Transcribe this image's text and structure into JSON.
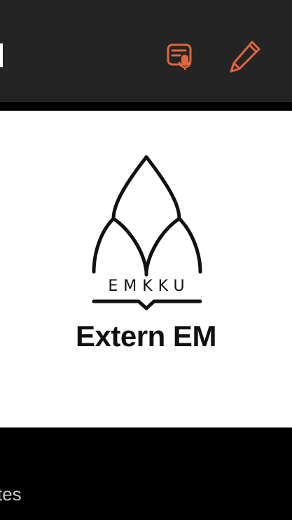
{
  "header": {
    "background": "#242424",
    "accent": "#E0663D",
    "actions": [
      {
        "icon": "transcript-mic-icon"
      },
      {
        "icon": "pencil-edit-icon"
      }
    ]
  },
  "hero": {
    "background": "#ffffff",
    "logo_letters": "EMKKU",
    "title": "Extern EM"
  },
  "footer": {
    "partial_label": "tes"
  }
}
